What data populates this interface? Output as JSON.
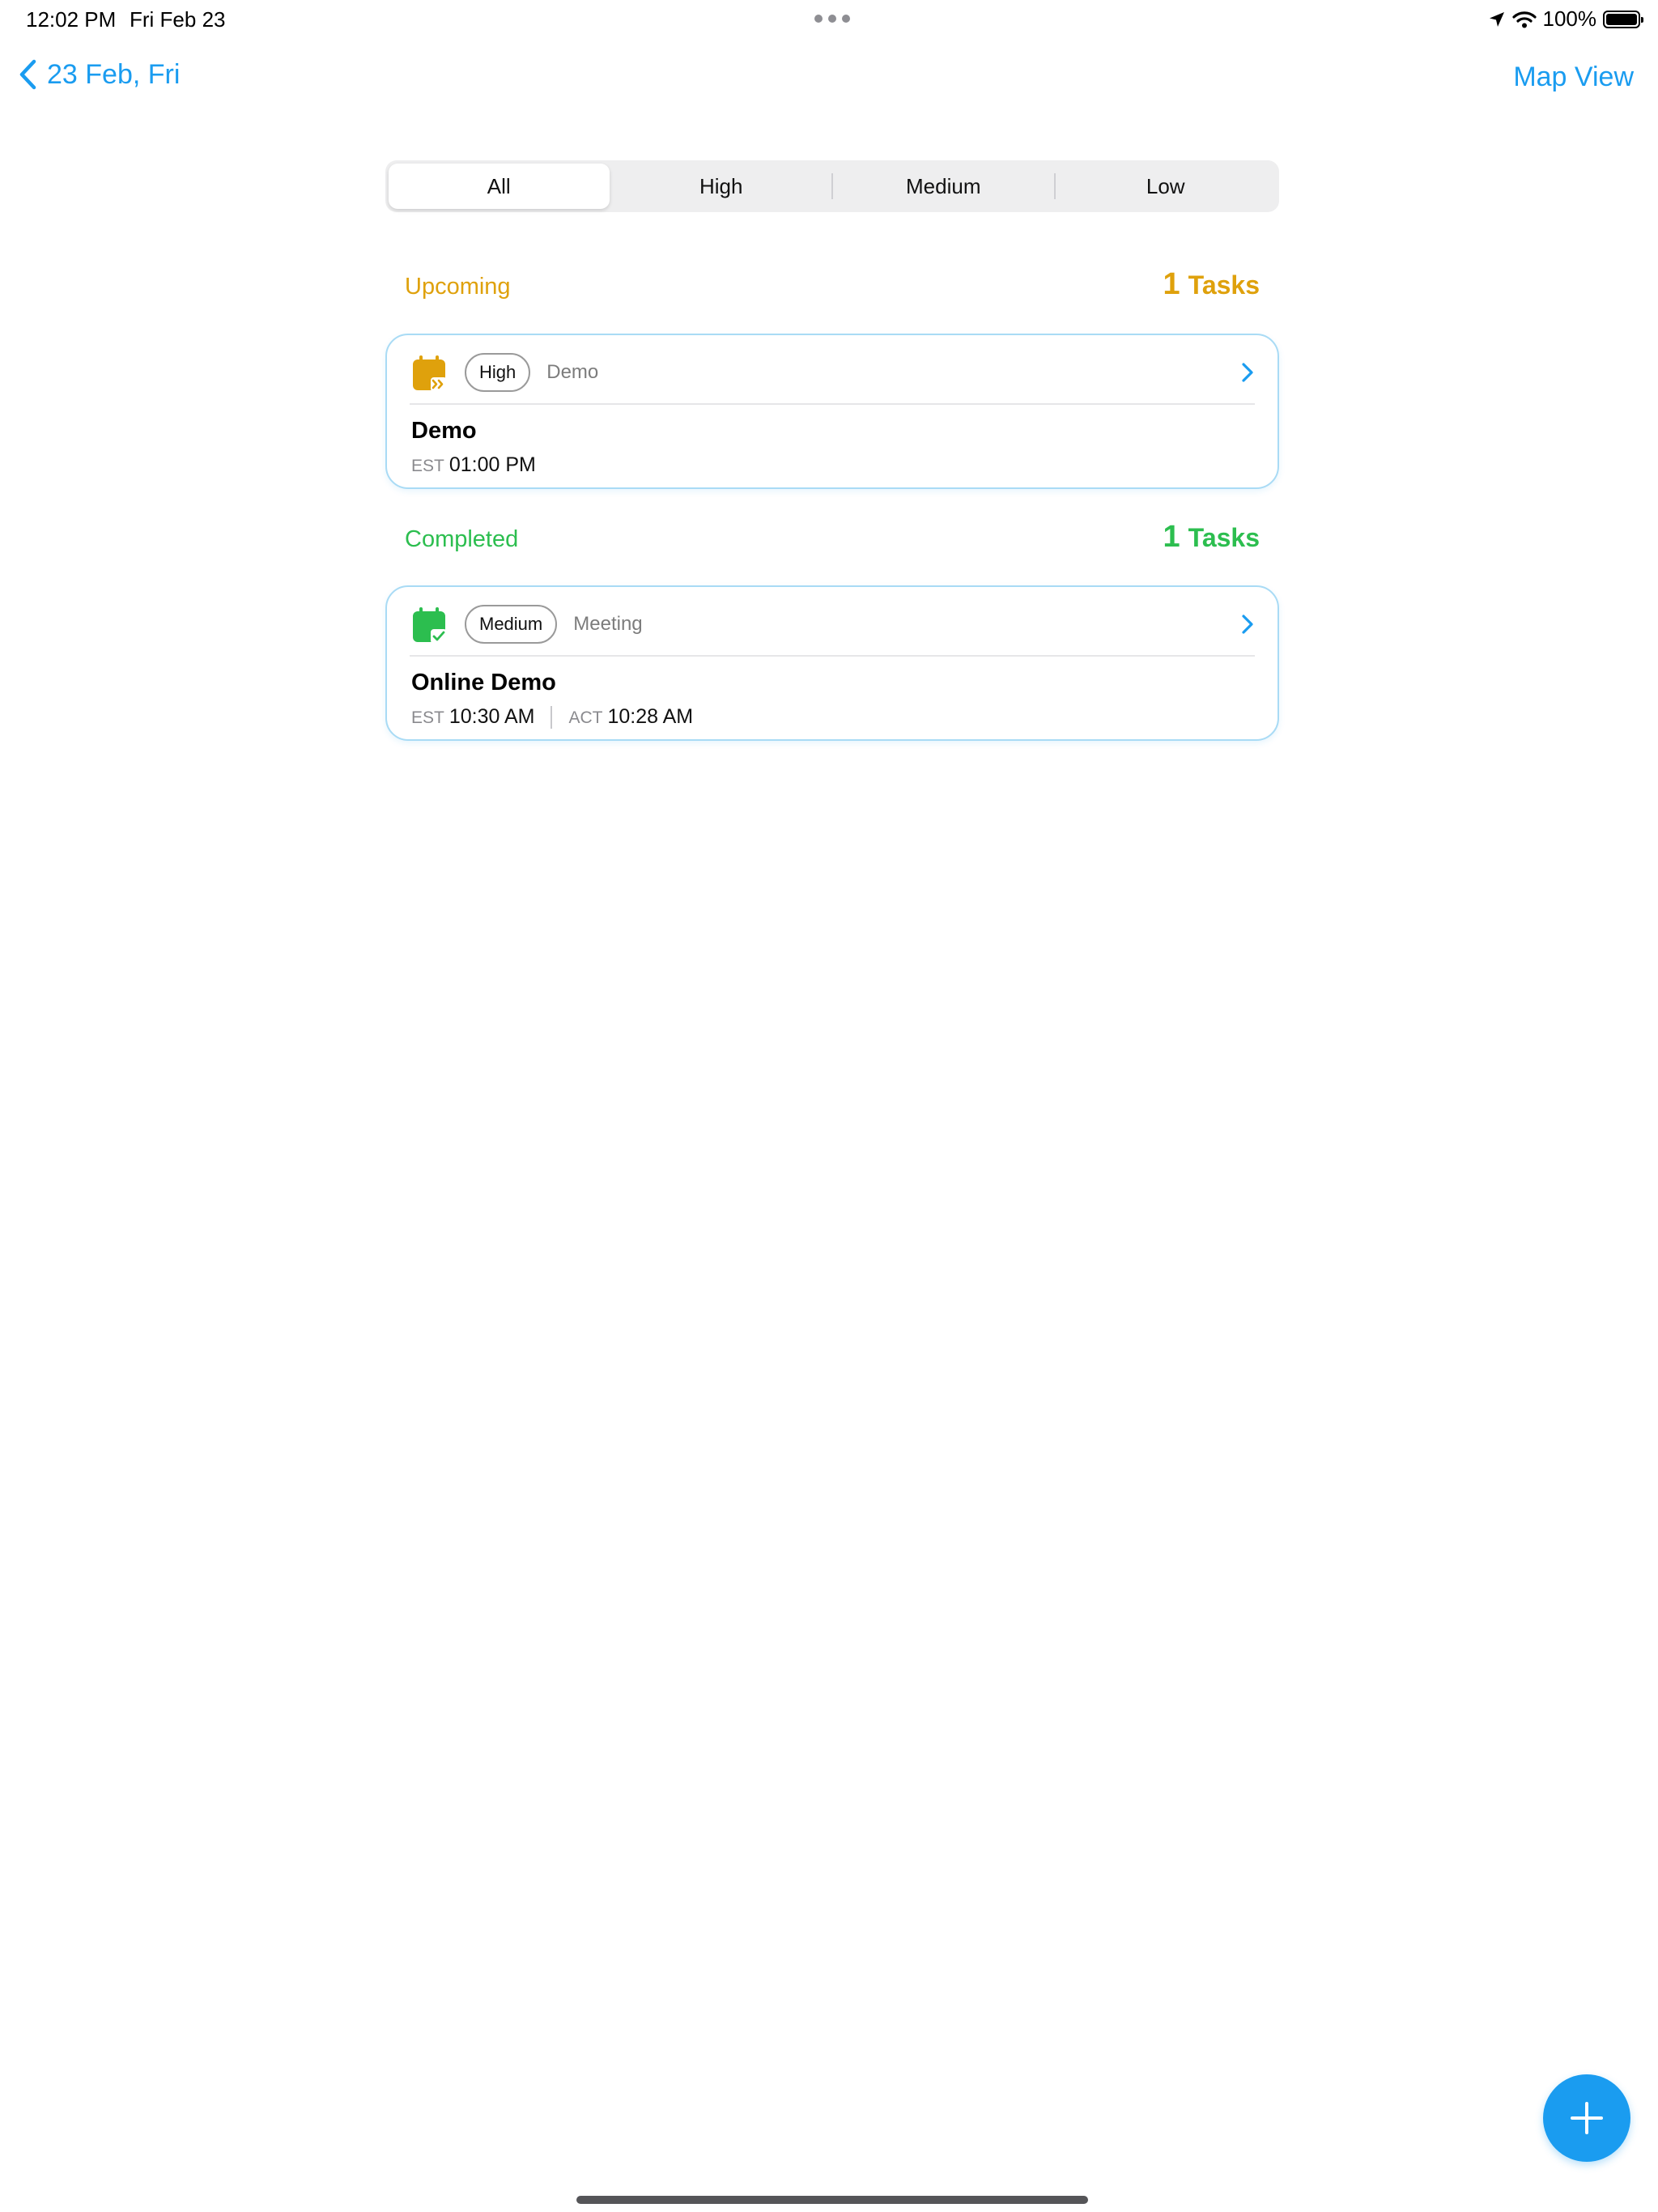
{
  "status_bar": {
    "time": "12:02 PM",
    "date": "Fri Feb 23",
    "battery": "100%"
  },
  "nav": {
    "back_label": "23 Feb, Fri",
    "map_view_label": "Map View"
  },
  "filter": {
    "segments": [
      "All",
      "High",
      "Medium",
      "Low"
    ],
    "selected": "All"
  },
  "sections": {
    "upcoming": {
      "title": "Upcoming",
      "count": "1",
      "count_unit": "Tasks",
      "color": "#dfa10c",
      "tasks": [
        {
          "priority": "High",
          "category": "Demo",
          "title": "Demo",
          "est_label": "EST",
          "est_time": "01:00 PM",
          "icon": "calendar-upcoming-icon"
        }
      ]
    },
    "completed": {
      "title": "Completed",
      "count": "1",
      "count_unit": "Tasks",
      "color": "#2cbe4f",
      "tasks": [
        {
          "priority": "Medium",
          "category": "Meeting",
          "title": "Online Demo",
          "est_label": "EST",
          "est_time": "10:30 AM",
          "act_label": "ACT",
          "act_time": "10:28 AM",
          "icon": "calendar-check-icon"
        }
      ]
    }
  },
  "colors": {
    "accent": "#1a9cf0",
    "card_border": "#a9dbf5"
  },
  "fab": {
    "icon": "plus-icon"
  }
}
